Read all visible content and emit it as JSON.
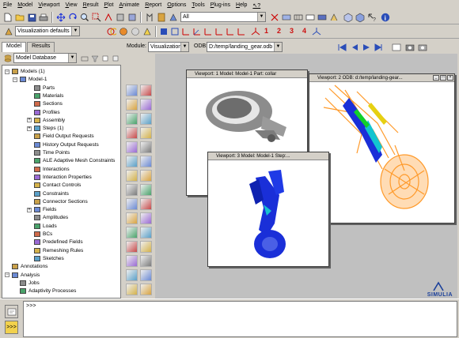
{
  "menu": [
    "File",
    "Model",
    "Viewport",
    "View",
    "Result",
    "Plot",
    "Animate",
    "Report",
    "Options",
    "Tools",
    "Plug-ins",
    "Help",
    "↖?"
  ],
  "toolbar": {
    "filter_select": "All",
    "visualization_select": "Visualization defaults",
    "step_numbers": [
      "1",
      "2",
      "3",
      "4"
    ]
  },
  "left_panel": {
    "tabs": [
      "Model",
      "Results"
    ],
    "database_select": "Model Database",
    "tree": [
      {
        "label": "Models (1)",
        "level": 0,
        "exp": "-",
        "icon": "models"
      },
      {
        "label": "Model-1",
        "level": 1,
        "exp": "-",
        "icon": "model"
      },
      {
        "label": "Parts",
        "level": 2,
        "exp": "",
        "icon": "parts"
      },
      {
        "label": "Materials",
        "level": 2,
        "exp": "",
        "icon": "materials"
      },
      {
        "label": "Sections",
        "level": 2,
        "exp": "",
        "icon": "sections"
      },
      {
        "label": "Profiles",
        "level": 2,
        "exp": "",
        "icon": "profiles"
      },
      {
        "label": "Assembly",
        "level": 2,
        "exp": "+",
        "icon": "assembly"
      },
      {
        "label": "Steps (1)",
        "level": 2,
        "exp": "+",
        "icon": "steps"
      },
      {
        "label": "Field Output Requests",
        "level": 2,
        "exp": "",
        "icon": "field-output"
      },
      {
        "label": "History Output Requests",
        "level": 2,
        "exp": "",
        "icon": "history-output"
      },
      {
        "label": "Time Points",
        "level": 2,
        "exp": "",
        "icon": "time-points"
      },
      {
        "label": "ALE Adaptive Mesh Constraints",
        "level": 2,
        "exp": "",
        "icon": "ale"
      },
      {
        "label": "Interactions",
        "level": 2,
        "exp": "",
        "icon": "interactions"
      },
      {
        "label": "Interaction Properties",
        "level": 2,
        "exp": "",
        "icon": "interaction-properties"
      },
      {
        "label": "Contact Controls",
        "level": 2,
        "exp": "",
        "icon": "contact-controls"
      },
      {
        "label": "Constraints",
        "level": 2,
        "exp": "",
        "icon": "constraints"
      },
      {
        "label": "Connector Sections",
        "level": 2,
        "exp": "",
        "icon": "connector-sections"
      },
      {
        "label": "Fields",
        "level": 2,
        "exp": "+",
        "icon": "fields"
      },
      {
        "label": "Amplitudes",
        "level": 2,
        "exp": "",
        "icon": "amplitudes"
      },
      {
        "label": "Loads",
        "level": 2,
        "exp": "",
        "icon": "loads"
      },
      {
        "label": "BCs",
        "level": 2,
        "exp": "",
        "icon": "bcs"
      },
      {
        "label": "Predefined Fields",
        "level": 2,
        "exp": "",
        "icon": "predefined-fields"
      },
      {
        "label": "Remeshing Rules",
        "level": 2,
        "exp": "",
        "icon": "remeshing-rules"
      },
      {
        "label": "Sketches",
        "level": 2,
        "exp": "",
        "icon": "sketches"
      },
      {
        "label": "Annotations",
        "level": 0,
        "exp": "",
        "icon": "annotations"
      },
      {
        "label": "Analysis",
        "level": 0,
        "exp": "-",
        "icon": "analysis"
      },
      {
        "label": "Jobs",
        "level": 1,
        "exp": "",
        "icon": "jobs"
      },
      {
        "label": "Adaptivity Processes",
        "level": 1,
        "exp": "",
        "icon": "adaptivity-processes"
      }
    ]
  },
  "context": {
    "module_label": "Module:",
    "module_value": "Visualization",
    "odb_label": "ODB:",
    "odb_value": "D:/temp/landing_gear.odb"
  },
  "viewports": [
    {
      "title": "Viewport: 1    Model: Model-1    Part: collar"
    },
    {
      "title": "Viewport: 2    ODB: d:/temp/landing-gear..."
    },
    {
      "title": "Viewport: 3    Model: Model-1    Step:..."
    }
  ],
  "message_area": {
    "prompt": ">>>"
  },
  "brand": {
    "logo_text": "SIMULIA"
  },
  "colors": {
    "mesh_blue": "#1a2fd8",
    "mesh_orange": "#ff9a2a",
    "accent_red": "#cc1010",
    "background": "#d4d0c8"
  }
}
